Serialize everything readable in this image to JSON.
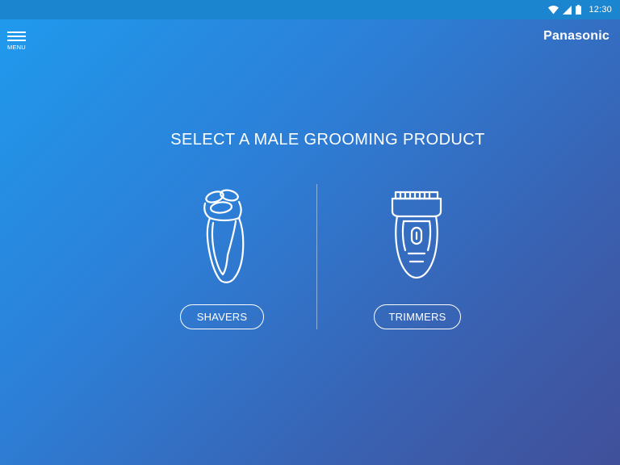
{
  "status_bar": {
    "time": "12:30",
    "icons": [
      "wifi-icon",
      "signal-icon",
      "battery-icon"
    ]
  },
  "header": {
    "menu_label": "MENU",
    "brand": "Panasonic"
  },
  "main": {
    "title": "SELECT A MALE GROOMING PRODUCT",
    "products": [
      {
        "label": "SHAVERS",
        "icon": "shaver-icon"
      },
      {
        "label": "TRIMMERS",
        "icon": "trimmer-icon"
      }
    ]
  },
  "colors": {
    "gradient_start": "#1f9bee",
    "gradient_end": "#41509a",
    "status_bar": "#1b86cf",
    "foreground": "#ffffff"
  }
}
